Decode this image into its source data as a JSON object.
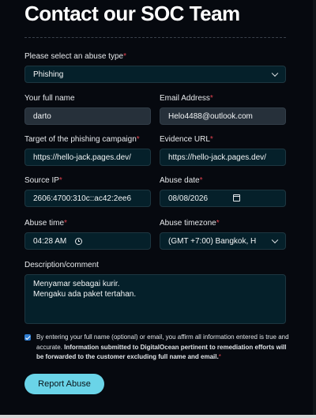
{
  "page": {
    "title": "Contact our SOC Team"
  },
  "form": {
    "abuse_type": {
      "label": "Please select an abuse type",
      "required": "*",
      "value": "Phishing"
    },
    "full_name": {
      "label": "Your full name",
      "value": "darto"
    },
    "email": {
      "label": "Email Address",
      "required": "*",
      "value": "Helo4488@outlook.com"
    },
    "target": {
      "label": "Target of the phishing campaign",
      "required": "*",
      "value": "https://hello-jack.pages.dev/"
    },
    "evidence_url": {
      "label": "Evidence URL",
      "required": "*",
      "value": "https://hello-jack.pages.dev/"
    },
    "source_ip": {
      "label": "Source IP",
      "required": "*",
      "value": "2606:4700:310c::ac42:2ee6"
    },
    "abuse_date": {
      "label": "Abuse date",
      "required": "*",
      "value": "08/08/2026"
    },
    "abuse_time": {
      "label": "Abuse time",
      "required": "*",
      "value": "04:28 AM"
    },
    "abuse_timezone": {
      "label": "Abuse timezone",
      "required": "*",
      "value": "(GMT +7:00) Bangkok, H"
    },
    "description": {
      "label": "Description/comment",
      "line1": "Menyamar sebagai kurir.",
      "line2": "Mengaku ada paket tertahan."
    },
    "consent": {
      "checked": true,
      "text_plain": "By entering your full name (optional) or email, you affirm all information entered is true and accurate.",
      "text_bold": "Information submitted to DigitalOcean pertinent to remediation efforts will be forwarded to the customer excluding full name and email.",
      "required": "*"
    },
    "submit_label": "Report Abuse"
  },
  "icons": {
    "select_arrow": "chevron-down-icon",
    "date": "calendar-icon",
    "time": "clock-icon",
    "consent_check": "checkbox-checked-icon"
  },
  "colors": {
    "background": "#06090f",
    "input_bg": "#05202a",
    "required": "#e0424f",
    "button": "#6ad4e8",
    "checkbox": "#2f7dd1"
  }
}
